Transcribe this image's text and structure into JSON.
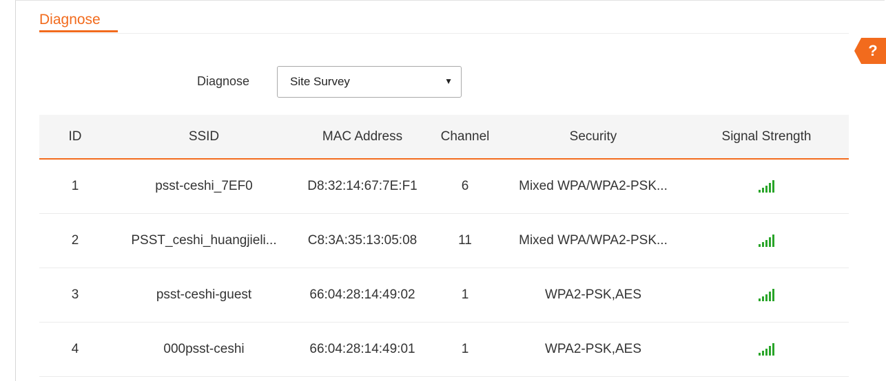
{
  "header": {
    "title": "Diagnose",
    "help_label": "?"
  },
  "form": {
    "label": "Diagnose",
    "select_value": "Site Survey"
  },
  "table": {
    "columns": [
      "ID",
      "SSID",
      "MAC Address",
      "Channel",
      "Security",
      "Signal Strength"
    ],
    "rows": [
      {
        "id": "1",
        "ssid": "psst-ceshi_7EF0",
        "mac": "D8:32:14:67:7E:F1",
        "channel": "6",
        "security": "Mixed WPA/WPA2-PSK...",
        "signal": 5
      },
      {
        "id": "2",
        "ssid": "PSST_ceshi_huangjieli...",
        "mac": "C8:3A:35:13:05:08",
        "channel": "11",
        "security": "Mixed WPA/WPA2-PSK...",
        "signal": 5
      },
      {
        "id": "3",
        "ssid": "psst-ceshi-guest",
        "mac": "66:04:28:14:49:02",
        "channel": "1",
        "security": "WPA2-PSK,AES",
        "signal": 5
      },
      {
        "id": "4",
        "ssid": "000psst-ceshi",
        "mac": "66:04:28:14:49:01",
        "channel": "1",
        "security": "WPA2-PSK,AES",
        "signal": 5
      }
    ]
  },
  "colors": {
    "accent": "#f26b1d",
    "signal": "#2aa52a"
  }
}
